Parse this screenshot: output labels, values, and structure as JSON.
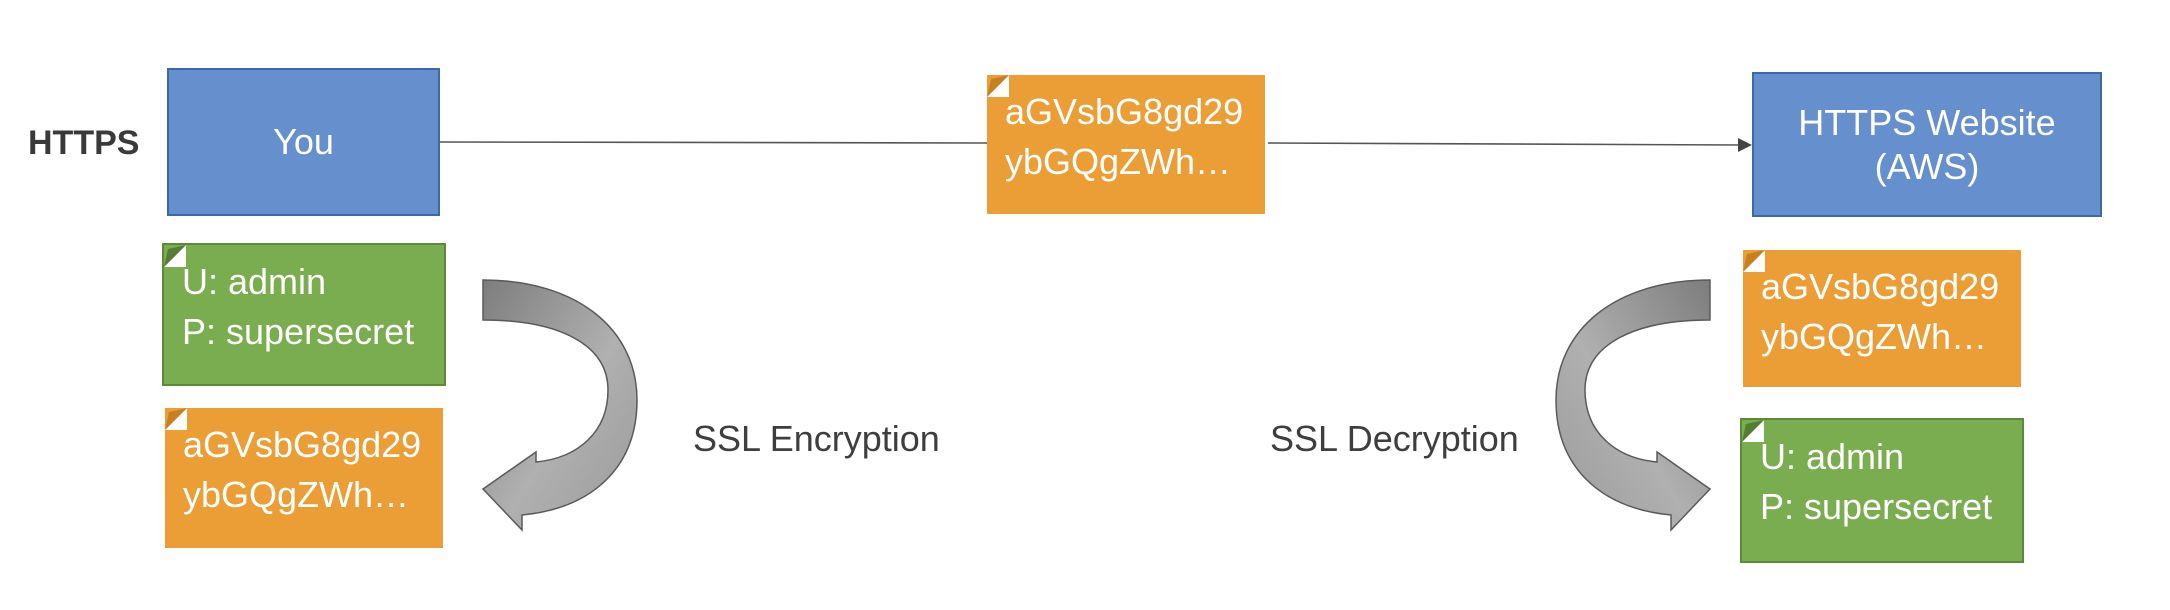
{
  "title": "HTTPS",
  "client": {
    "label": "You"
  },
  "server": {
    "label_line1": "HTTPS Website",
    "label_line2": "(AWS)"
  },
  "transit_note": {
    "line1": "aGVsbG8gd29",
    "line2": "ybGQgZWh…"
  },
  "client_plain": {
    "line1": "U: admin",
    "line2": "P: supersecret"
  },
  "client_cipher": {
    "line1": "aGVsbG8gd29",
    "line2": "ybGQgZWh…"
  },
  "server_cipher": {
    "line1": "aGVsbG8gd29",
    "line2": "ybGQgZWh…"
  },
  "server_plain": {
    "line1": "U: admin",
    "line2": "P: supersecret"
  },
  "encryption_label": "SSL Encryption",
  "decryption_label": "SSL Decryption",
  "colors": {
    "box_blue": "#6590cd",
    "note_orange": "#eb9e36",
    "note_green": "#7aad4f",
    "arrow_gray": "#8c8c8c"
  }
}
